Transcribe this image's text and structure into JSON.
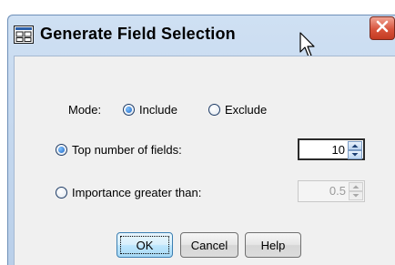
{
  "window": {
    "title": "Generate Field Selection",
    "close_glyph": "✕",
    "title_icon": "dialog-app-icon"
  },
  "mode": {
    "label": "Mode:",
    "options": [
      {
        "label": "Include",
        "checked": true
      },
      {
        "label": "Exclude",
        "checked": false
      }
    ]
  },
  "top_number": {
    "label": "Top number of fields:",
    "checked": true,
    "value": "10"
  },
  "importance": {
    "label": "Importance greater than:",
    "checked": false,
    "value": "0.5"
  },
  "buttons": {
    "ok_label": "OK",
    "cancel_label": "Cancel",
    "help_label": "Help"
  },
  "colors": {
    "title_bar": "#c7dbf2",
    "close_button": "#d8543c",
    "client_bg": "#f0f0f0",
    "radio_dot": "#1f66c4"
  }
}
